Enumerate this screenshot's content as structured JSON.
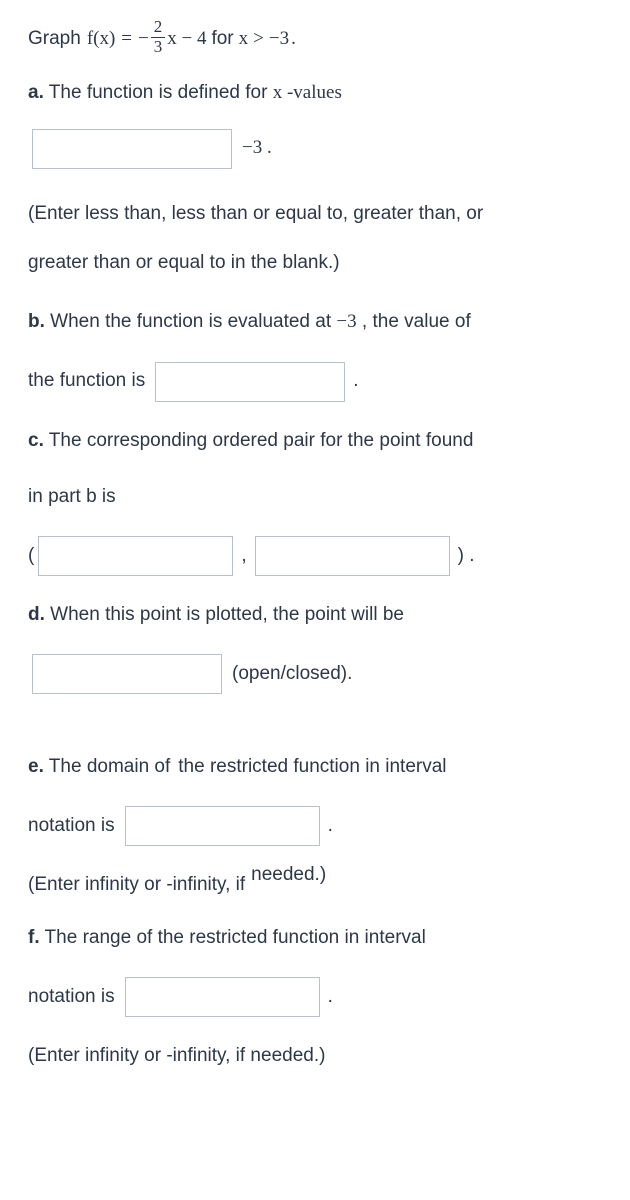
{
  "intro": {
    "graph": "Graph",
    "fx": "f(x)",
    "eq": "=",
    "neg": "−",
    "num": "2",
    "den": "3",
    "xminus4": "x − 4",
    "forx": "for",
    "x": "x",
    "gt": ">",
    "neg3": "−3",
    "dot": "."
  },
  "a": {
    "label": "a.",
    "text": "The function is defined for",
    "xvalues": "x -values",
    "after_input": "−3 .",
    "hint1": "(Enter less than, less than or equal to, greater than, or",
    "hint2": "greater than or equal to in the blank.)"
  },
  "b": {
    "label": "b.",
    "text1": "When the function is evaluated at",
    "neg3": "−3",
    "text2": ", the value of",
    "text3": "the function is",
    "dot": "."
  },
  "c": {
    "label": "c.",
    "text1": "The corresponding ordered pair for the point found",
    "text2": "in part b is",
    "lparen": "(",
    "comma": ",",
    "rparen_dot": ") ."
  },
  "d": {
    "label": "d.",
    "text": "When this point is plotted, the point will be",
    "after": "(open/closed)."
  },
  "e": {
    "label": "e.",
    "text1": "The domain of",
    "text2": "the restricted function in interval",
    "text3": "notation is",
    "dot": ".",
    "hint": "(Enter infinity or -infinity, if",
    "needed": "needed.)"
  },
  "f": {
    "label": "f.",
    "text1": "The range of the restricted function in interval",
    "text2": "notation is",
    "dot": ".",
    "hint": "(Enter infinity or -infinity, if needed.)"
  }
}
